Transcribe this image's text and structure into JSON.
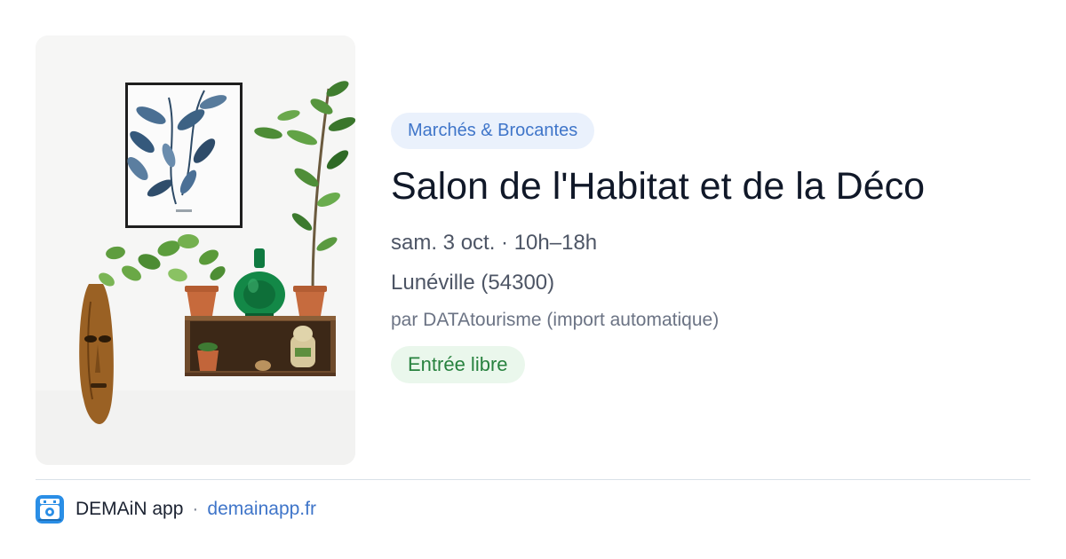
{
  "event": {
    "category": "Marchés & Brocantes",
    "title": "Salon de l'Habitat et de la Déco",
    "datetime": "sam. 3 oct. · 10h–18h",
    "location": "Lunéville (54300)",
    "source": "par DATAtourisme (import automatique)",
    "price_tag": "Entrée libre"
  },
  "footer": {
    "app_name": "DEMAiN app",
    "separator": "·",
    "url": "demainapp.fr",
    "logo_icon": "demain-app-logo-icon"
  },
  "colors": {
    "category_bg": "#eaf1fc",
    "category_text": "#3f75c9",
    "price_bg": "#eaf7ec",
    "price_text": "#28823f",
    "link": "#3f75c9",
    "logo_bg": "#2a8ee6"
  }
}
